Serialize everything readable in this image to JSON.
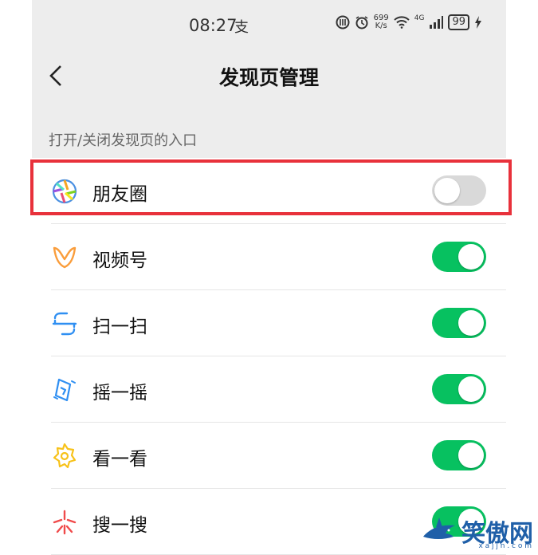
{
  "status_bar": {
    "time": "08:27",
    "pay_glyph": "支",
    "speed_value": "699",
    "speed_unit": "K/s",
    "network": "4G",
    "battery": "99"
  },
  "header": {
    "title": "发现页管理"
  },
  "section": {
    "label": "打开/关闭发现页的入口"
  },
  "items": [
    {
      "label": "朋友圈",
      "icon": "moments-icon",
      "enabled": false
    },
    {
      "label": "视频号",
      "icon": "channels-icon",
      "enabled": true
    },
    {
      "label": "扫一扫",
      "icon": "scan-icon",
      "enabled": true
    },
    {
      "label": "摇一摇",
      "icon": "shake-icon",
      "enabled": true
    },
    {
      "label": "看一看",
      "icon": "top-stories-icon",
      "enabled": true
    },
    {
      "label": "搜一搜",
      "icon": "search-icon",
      "enabled": true
    }
  ],
  "colors": {
    "toggle_on": "#07c160",
    "toggle_off": "#d9d9d9",
    "highlight": "#e8313b"
  },
  "watermark": {
    "text": "笑傲网",
    "sub": "x a j j n . c o m"
  }
}
